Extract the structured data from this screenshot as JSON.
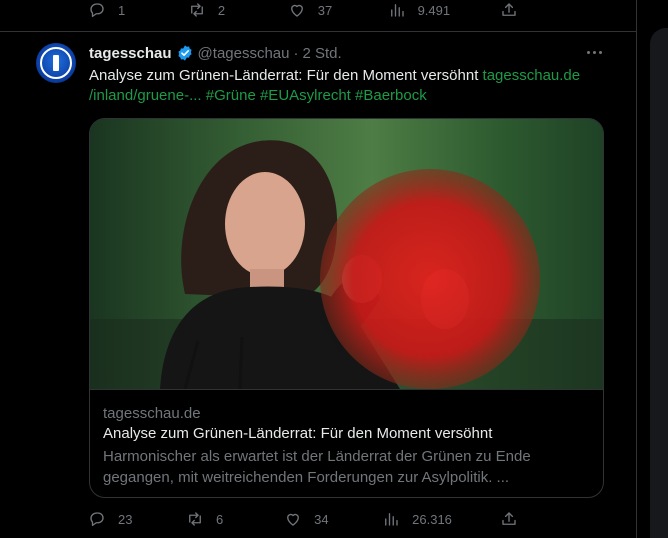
{
  "prev_tweet": {
    "actions": {
      "replies": "1",
      "reposts": "2",
      "likes": "37",
      "views": "9.491"
    }
  },
  "tweet": {
    "author_name": "tagesschau",
    "author_handle": "@tagesschau",
    "separator": "·",
    "time": "2 Std.",
    "text_main": "Analyse zum Grünen-Länderrat: Für den Moment versöhnt ",
    "link_part1": "tagesschau.de",
    "link_part2": "/inland/gruene-...",
    "hashtags": [
      "#Grüne",
      "#EUAsylrecht",
      "#Baerbock"
    ],
    "card": {
      "domain": "tagesschau.de",
      "title": "Analyse zum Grünen-Länderrat: Für den Moment versöhnt",
      "description": "Harmonischer als erwartet ist der Länderrat der Grünen zu Ende gegangen, mit weitreichenden Forderungen zur Asylpolitik. ..."
    },
    "actions": {
      "replies": "23",
      "reposts": "6",
      "likes": "34",
      "views": "26.316"
    }
  },
  "colors": {
    "background": "#000000",
    "text": "#e7e9ea",
    "muted": "#71767b",
    "link": "#1d9b48",
    "verified": "#1d9bf0",
    "border": "#2f3336"
  },
  "icons": [
    "reply-icon",
    "repost-icon",
    "like-icon",
    "views-icon",
    "share-icon",
    "verified-icon",
    "more-icon"
  ]
}
